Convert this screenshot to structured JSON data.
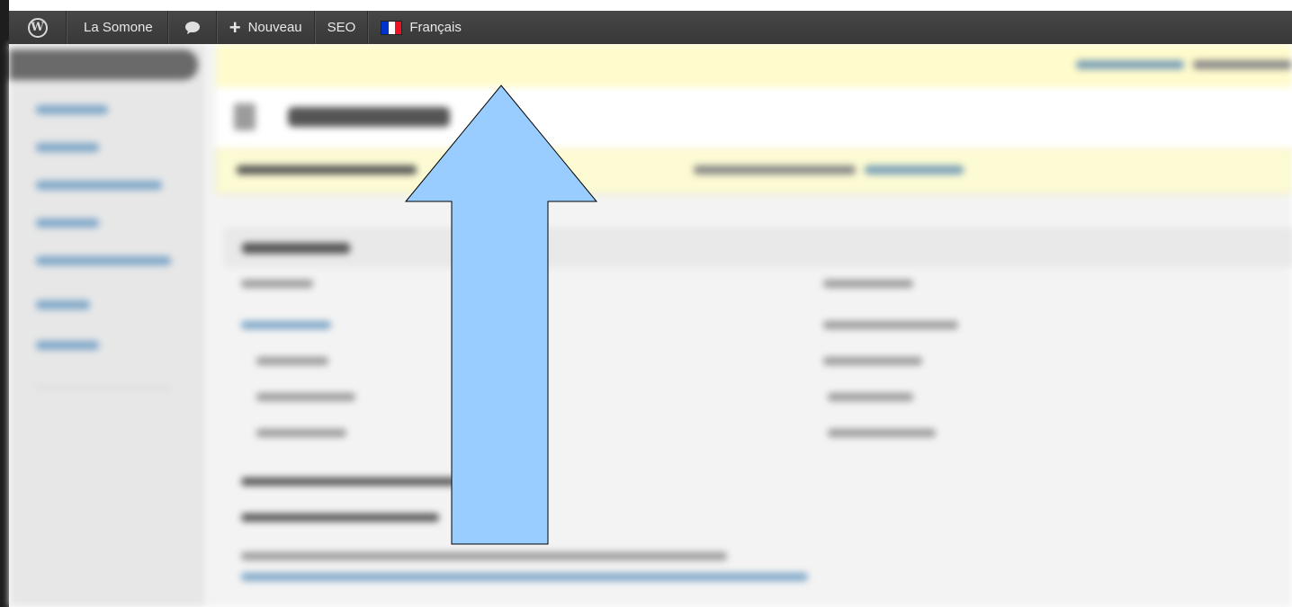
{
  "adminbar": {
    "wp_logo_icon": "wordpress-logo-icon",
    "site_name": "La Somone",
    "comments_icon": "speech-bubble-icon",
    "new_plus": "+",
    "new_label": "Nouveau",
    "seo_label": "SEO",
    "language_label": "Français",
    "language_flag_colors": [
      "#0033cc",
      "#ffffff",
      "#ee1122"
    ],
    "background": "#3f3f3f"
  },
  "overlay": {
    "arrow_icon": "up-arrow",
    "arrow_fill": "#99ccff",
    "arrow_stroke": "#000000"
  }
}
